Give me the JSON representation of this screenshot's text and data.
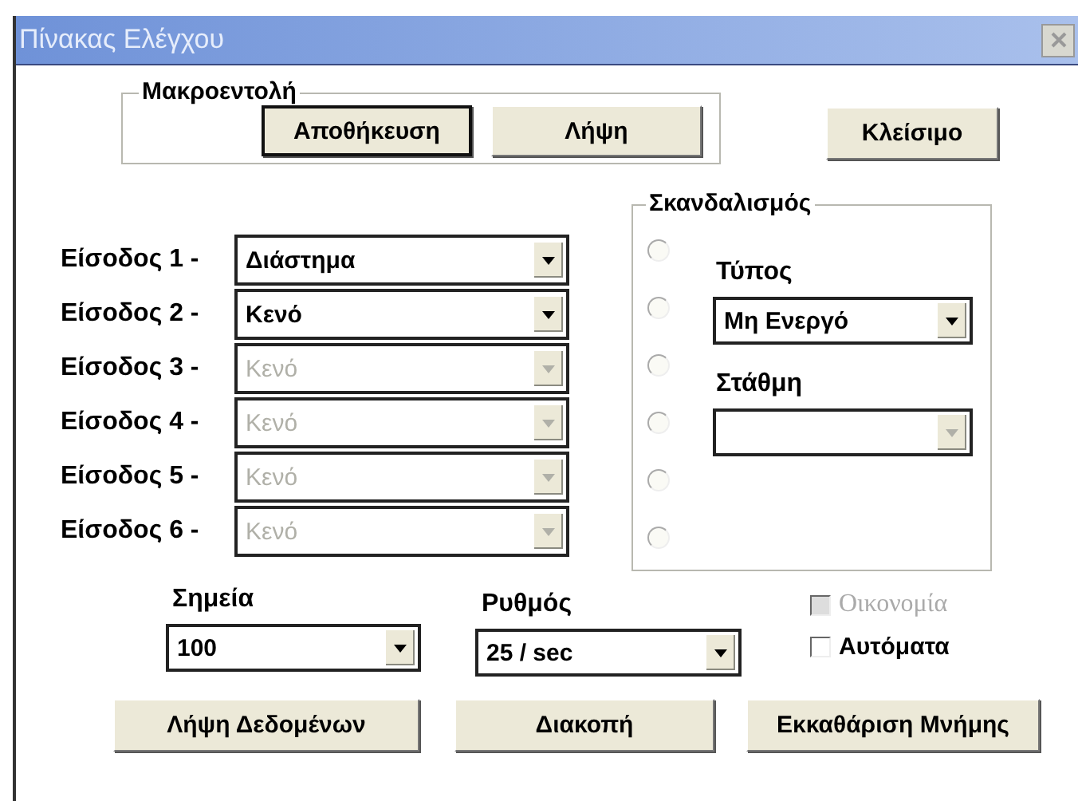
{
  "window": {
    "title": "Πίνακας Ελέγχου"
  },
  "macro": {
    "legend": "Μακροεντολή",
    "buttons": [
      {
        "label": "Αποθήκευση",
        "default": true
      },
      {
        "label": "Λήψη",
        "default": false
      }
    ]
  },
  "close_button": {
    "label": "Κλείσιμο"
  },
  "inputs": [
    {
      "label": "Είσοδος 1 -",
      "value": "Διάστημα",
      "disabled": false
    },
    {
      "label": "Είσοδος 2 -",
      "value": "Κενό",
      "disabled": false
    },
    {
      "label": "Είσοδος 3 -",
      "value": "Κενό",
      "disabled": true
    },
    {
      "label": "Είσοδος 4 -",
      "value": "Κενό",
      "disabled": true
    },
    {
      "label": "Είσοδος 5 -",
      "value": "Κενό",
      "disabled": true
    },
    {
      "label": "Είσοδος 6 -",
      "value": "Κενό",
      "disabled": true
    }
  ],
  "trigger": {
    "legend": "Σκανδαλισμός",
    "radios": [
      {
        "selected": false
      },
      {
        "selected": false
      },
      {
        "selected": false
      },
      {
        "selected": false
      },
      {
        "selected": false
      },
      {
        "selected": false
      }
    ],
    "type": {
      "label": "Τύπος",
      "value": "Μη Ενεργό",
      "disabled": false
    },
    "threshold": {
      "label": "Στάθμη",
      "disabled": true
    }
  },
  "points": {
    "label": "Σημεία",
    "value": "100"
  },
  "rate": {
    "label": "Ρυθμός",
    "value": "25 / sec"
  },
  "checkboxes": [
    {
      "label": "Οικονομία",
      "checked": false,
      "disabled": true
    },
    {
      "label": "Αυτόματα",
      "checked": false,
      "disabled": false
    }
  ],
  "buttons": [
    "Λήψη Δεδομένων",
    "Διακοπή",
    "Εκκαθάριση Μνήμης"
  ]
}
